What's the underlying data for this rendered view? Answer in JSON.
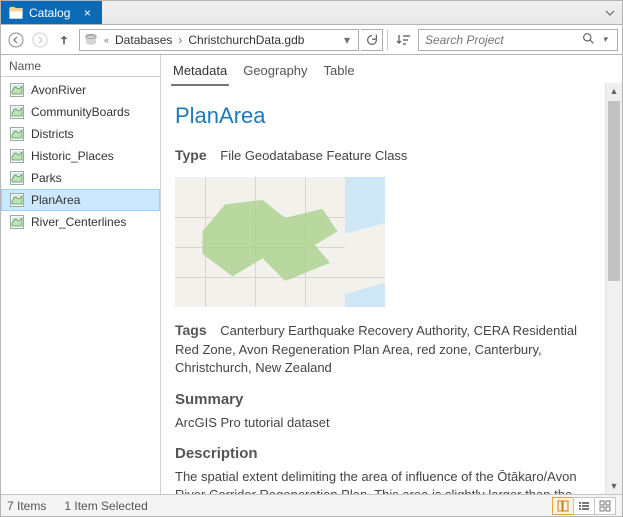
{
  "tab": {
    "title": "Catalog"
  },
  "breadcrumb": {
    "level1": "Databases",
    "level2": "ChristchurchData.gdb"
  },
  "search": {
    "placeholder": "Search Project"
  },
  "sidebar": {
    "header": "Name",
    "items": [
      {
        "label": "AvonRiver",
        "selected": false
      },
      {
        "label": "CommunityBoards",
        "selected": false
      },
      {
        "label": "Districts",
        "selected": false
      },
      {
        "label": "Historic_Places",
        "selected": false
      },
      {
        "label": "Parks",
        "selected": false
      },
      {
        "label": "PlanArea",
        "selected": true
      },
      {
        "label": "River_Centerlines",
        "selected": false
      }
    ]
  },
  "content_tabs": [
    {
      "label": "Metadata",
      "active": true
    },
    {
      "label": "Geography",
      "active": false
    },
    {
      "label": "Table",
      "active": false
    }
  ],
  "detail": {
    "title": "PlanArea",
    "type_label": "Type",
    "type_value": "File Geodatabase Feature Class",
    "tags_label": "Tags",
    "tags_value": "Canterbury Earthquake Recovery Authority, CERA Residential Red Zone, Avon Regeneration Plan Area, red zone, Canterbury, Christchurch, New Zealand",
    "summary_label": "Summary",
    "summary_value": "ArcGIS Pro tutorial dataset",
    "description_label": "Description",
    "description_value": "The spatial extent delimiting the area of influence of the Ōtākaro/Avon River Corridor Regeneration Plan. This area is slightly larger than the"
  },
  "status": {
    "items": "7 Items",
    "selected": "1 Item Selected"
  }
}
